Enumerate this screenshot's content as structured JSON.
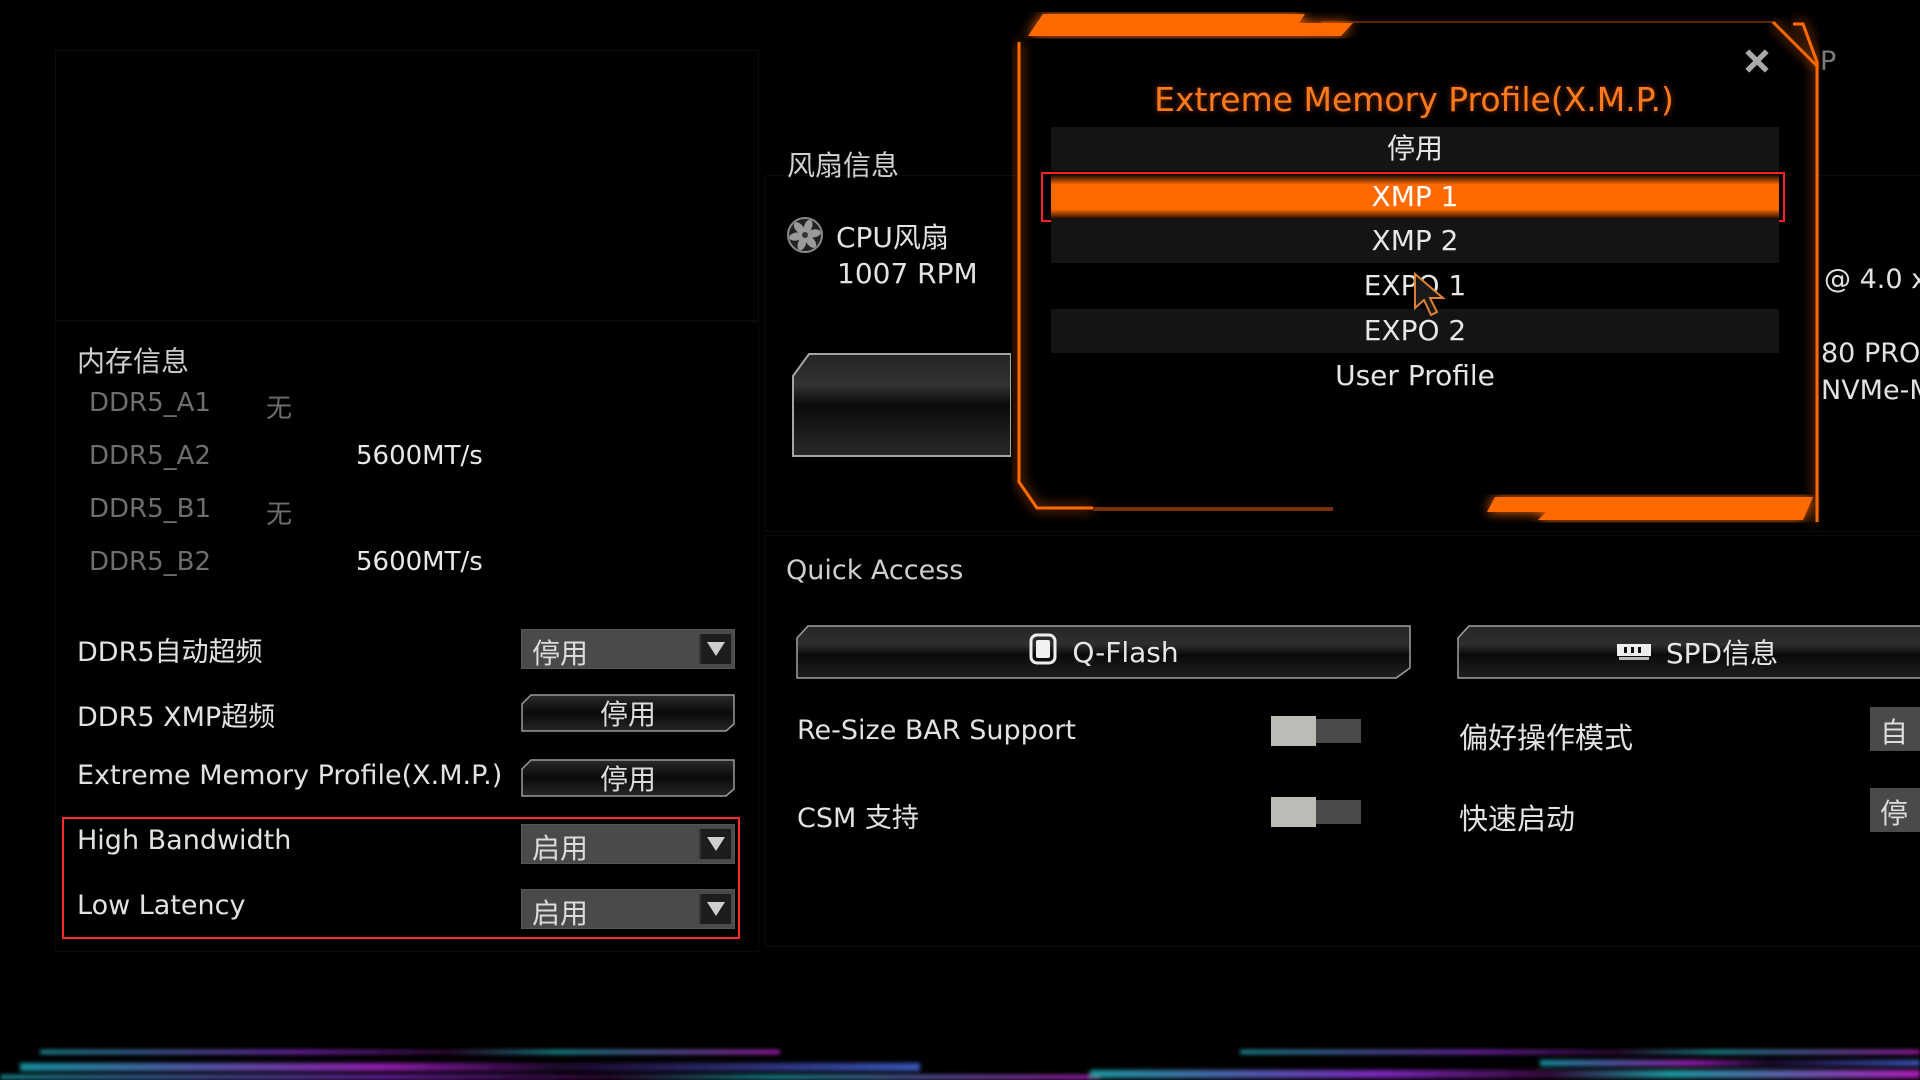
{
  "memory_info": {
    "title": "内存信息",
    "slots": [
      {
        "name": "DDR5_A1",
        "status": "无",
        "speed": ""
      },
      {
        "name": "DDR5_A2",
        "status": "",
        "speed": "5600MT/s"
      },
      {
        "name": "DDR5_B1",
        "status": "无",
        "speed": ""
      },
      {
        "name": "DDR5_B2",
        "status": "",
        "speed": "5600MT/s"
      }
    ]
  },
  "memory_settings": [
    {
      "label": "DDR5自动超频",
      "value": "停用",
      "control": "select"
    },
    {
      "label": "DDR5 XMP超频",
      "value": "停用",
      "control": "button"
    },
    {
      "label": "Extreme Memory Profile(X.M.P.)",
      "value": "停用",
      "control": "button"
    },
    {
      "label": "High Bandwidth",
      "value": "启用",
      "control": "select",
      "highlighted": true
    },
    {
      "label": "Low Latency",
      "value": "启用",
      "control": "select",
      "highlighted": true
    }
  ],
  "fan_info": {
    "title": "风扇信息",
    "fans": [
      {
        "name": "CPU风扇",
        "speed": "1007 RPM",
        "icon": "fan-icon"
      }
    ]
  },
  "quick_access": {
    "title": "Quick Access",
    "buttons": [
      {
        "label": "Q-Flash",
        "icon": "chip-icon"
      },
      {
        "label": "SPD信息",
        "icon": "ram-module-icon"
      }
    ],
    "toggles": [
      {
        "label": "Re-Size BAR Support",
        "state": "off"
      },
      {
        "label": "CSM 支持",
        "state": "off"
      }
    ],
    "options": [
      {
        "label": "偏好操作模式",
        "value": "自动"
      },
      {
        "label": "快速启动",
        "value": "停用"
      }
    ]
  },
  "right_edge": {
    "partial_p": "P",
    "pcie": "@ 4.0 x",
    "ssd_model": "80 PRO",
    "ssd_type": "NVMe-M"
  },
  "popup": {
    "title": "Extreme Memory Profile(X.M.P.)",
    "close_icon": "close-icon",
    "options": [
      "停用",
      "XMP 1",
      "XMP 2",
      "EXPO 1",
      "EXPO 2",
      "User Profile"
    ],
    "selected_index": 1,
    "hovered": "EXPO 1"
  },
  "colors": {
    "accent": "#ff6a00",
    "title_accent": "#ff7a1a",
    "highlight_box": "#ff2a2a",
    "background": "#000000"
  }
}
